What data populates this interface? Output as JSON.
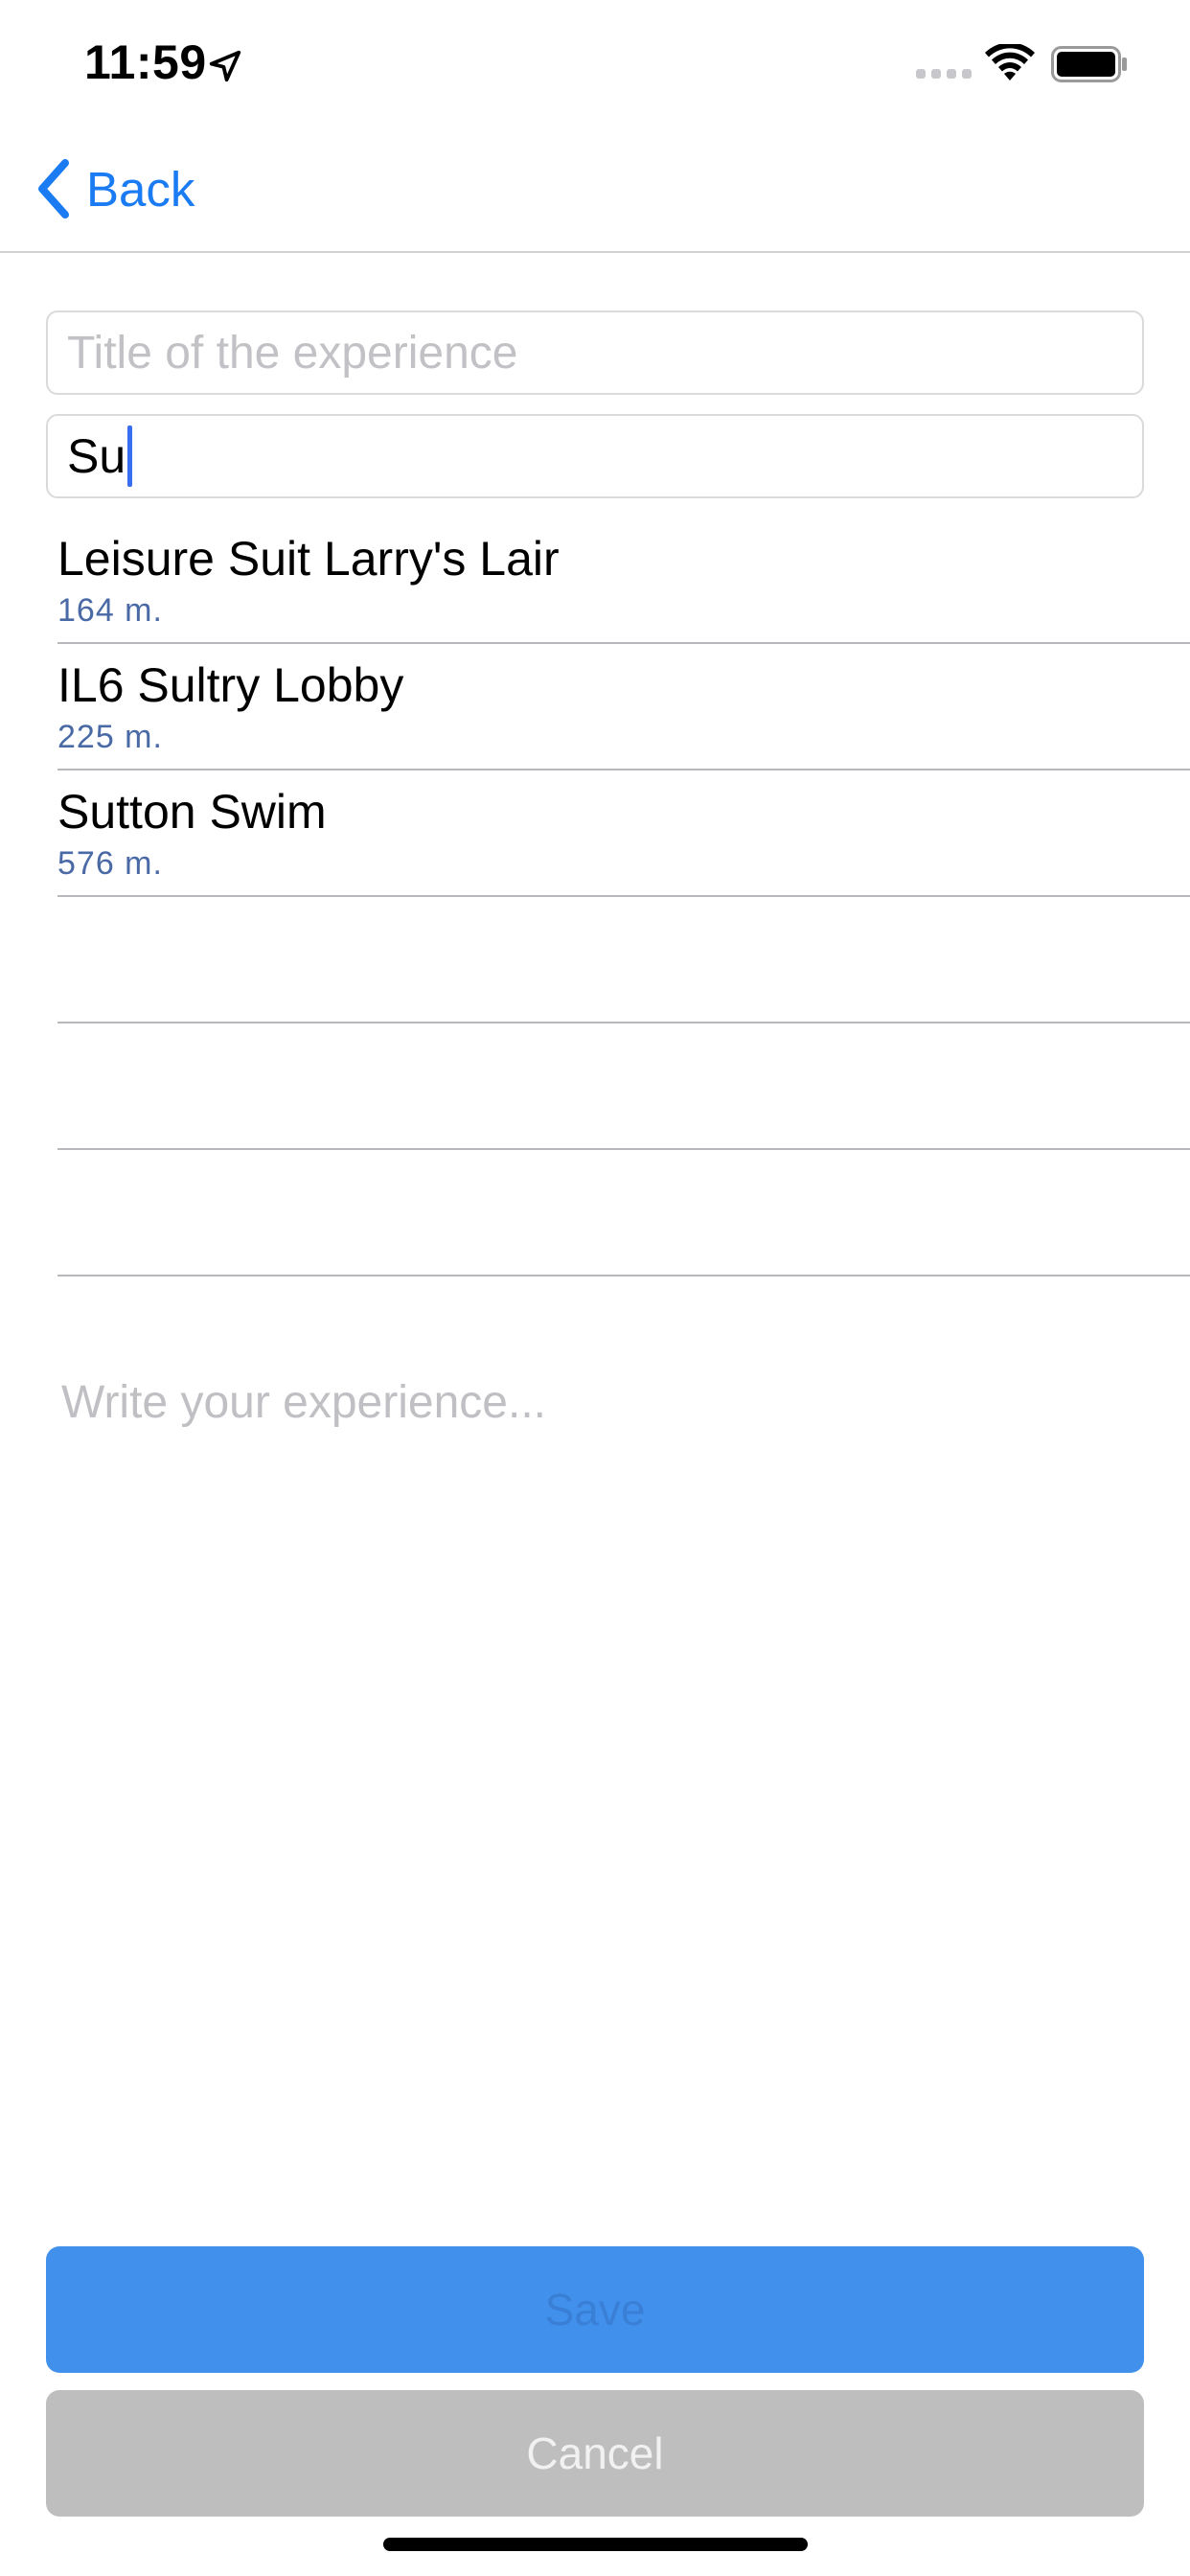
{
  "status_bar": {
    "time": "11:59"
  },
  "nav": {
    "back_label": "Back"
  },
  "form": {
    "title_placeholder": "Title of the experience",
    "title_value": "",
    "location_query": "Su",
    "experience_placeholder": "Write your experience..."
  },
  "results": [
    {
      "name": "Leisure Suit Larry's Lair",
      "distance": "164 m."
    },
    {
      "name": "IL6 Sultry Lobby",
      "distance": "225 m."
    },
    {
      "name": "Sutton Swim",
      "distance": "576 m."
    },
    {
      "name": "",
      "distance": ""
    },
    {
      "name": "",
      "distance": ""
    },
    {
      "name": "",
      "distance": ""
    }
  ],
  "buttons": {
    "save_label": "Save",
    "cancel_label": "Cancel"
  },
  "colors": {
    "accent": "#1a7bf2",
    "save_bg": "#4190ec",
    "cancel_bg": "#bebebe",
    "subtitle": "#4a6aa6"
  }
}
